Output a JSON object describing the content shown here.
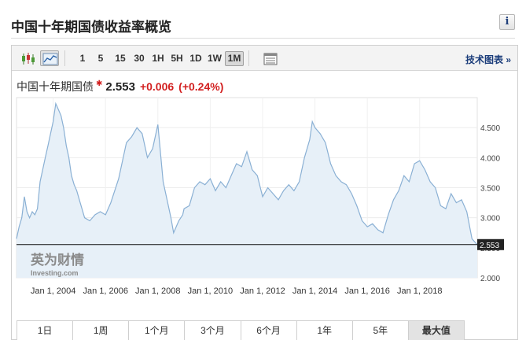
{
  "header": {
    "title": "中国十年期国债收益率概览",
    "info_label": "i"
  },
  "toolbar": {
    "timeframes": [
      "1",
      "5",
      "15",
      "30",
      "1H",
      "5H",
      "1D",
      "1W",
      "1M"
    ],
    "active_timeframe": "1M",
    "tech_chart_link": "技术图表 »"
  },
  "quote": {
    "name": "中国十年期国债",
    "value": "2.553",
    "change": "+0.006",
    "change_pct": "(+0.24%)"
  },
  "watermark": {
    "cn": "英为财情",
    "en": "Investing.com"
  },
  "ranges": [
    "1日",
    "1周",
    "1个月",
    "3个月",
    "6个月",
    "1年",
    "5年",
    "最大值"
  ],
  "active_range": "最大值",
  "colors": {
    "line": "#8ab0d4",
    "area": "#e7f0f8",
    "positive": "#d21f1f",
    "link": "#1a3c7a"
  },
  "chart_data": {
    "type": "area",
    "title": "",
    "xlabel": "",
    "ylabel": "",
    "ylim": [
      2.0,
      5.0
    ],
    "yticks": [
      "4.500",
      "4.000",
      "3.500",
      "3.000",
      "2.500",
      "2.000"
    ],
    "ytick_values": [
      4.5,
      4.0,
      3.5,
      3.0,
      2.5,
      2.0
    ],
    "xticks": [
      "Jan 1, 2004",
      "Jan 1, 2006",
      "Jan 1, 2008",
      "Jan 1, 2010",
      "Jan 1, 2012",
      "Jan 1, 2014",
      "Jan 1, 2016",
      "Jan 1, 2018"
    ],
    "xtick_values": [
      2004,
      2006,
      2008,
      2010,
      2012,
      2014,
      2016,
      2018
    ],
    "xlim": [
      2002.6,
      2020.2
    ],
    "last_price": 2.553,
    "last_price_label": "2.553",
    "series": [
      {
        "x": [
          2002.6,
          2002.7,
          2002.8,
          2002.9,
          2003.0,
          2003.1,
          2003.2,
          2003.3,
          2003.4,
          2003.5,
          2003.6,
          2003.7,
          2003.8,
          2003.9,
          2004.0,
          2004.1,
          2004.2,
          2004.3,
          2004.4,
          2004.5,
          2004.6,
          2004.7,
          2004.8,
          2004.9,
          2005.0,
          2005.2,
          2005.4,
          2005.6,
          2005.8,
          2006.0,
          2006.2,
          2006.5,
          2006.8,
          2007.0,
          2007.2,
          2007.4,
          2007.6,
          2007.8,
          2008.0,
          2008.2,
          2008.4,
          2008.5,
          2008.6,
          2008.8,
          2008.95,
          2009.0,
          2009.2,
          2009.4,
          2009.6,
          2009.8,
          2010.0,
          2010.2,
          2010.4,
          2010.6,
          2010.8,
          2011.0,
          2011.2,
          2011.4,
          2011.6,
          2011.8,
          2012.0,
          2012.2,
          2012.4,
          2012.6,
          2012.8,
          2013.0,
          2013.2,
          2013.4,
          2013.6,
          2013.8,
          2013.9,
          2014.0,
          2014.2,
          2014.4,
          2014.6,
          2014.8,
          2015.0,
          2015.2,
          2015.4,
          2015.6,
          2015.8,
          2016.0,
          2016.2,
          2016.4,
          2016.6,
          2016.8,
          2017.0,
          2017.2,
          2017.4,
          2017.6,
          2017.8,
          2018.0,
          2018.2,
          2018.4,
          2018.6,
          2018.8,
          2019.0,
          2019.2,
          2019.4,
          2019.6,
          2019.8,
          2020.0,
          2020.2
        ],
        "y": [
          2.65,
          2.85,
          3.0,
          3.35,
          3.1,
          3.0,
          3.1,
          3.05,
          3.15,
          3.6,
          3.8,
          4.0,
          4.2,
          4.4,
          4.6,
          4.9,
          4.8,
          4.7,
          4.5,
          4.2,
          4.0,
          3.7,
          3.55,
          3.45,
          3.3,
          3.0,
          2.95,
          3.05,
          3.1,
          3.05,
          3.25,
          3.65,
          4.25,
          4.35,
          4.5,
          4.4,
          4.0,
          4.15,
          4.55,
          3.6,
          3.2,
          3.0,
          2.75,
          2.95,
          3.05,
          3.15,
          3.2,
          3.5,
          3.6,
          3.55,
          3.65,
          3.45,
          3.6,
          3.5,
          3.7,
          3.9,
          3.85,
          4.1,
          3.8,
          3.7,
          3.35,
          3.5,
          3.4,
          3.3,
          3.45,
          3.55,
          3.45,
          3.6,
          4.0,
          4.3,
          4.6,
          4.5,
          4.4,
          4.25,
          3.9,
          3.7,
          3.6,
          3.55,
          3.4,
          3.2,
          2.95,
          2.85,
          2.9,
          2.8,
          2.75,
          3.05,
          3.3,
          3.45,
          3.7,
          3.6,
          3.9,
          3.95,
          3.8,
          3.6,
          3.5,
          3.2,
          3.15,
          3.4,
          3.25,
          3.3,
          3.1,
          2.65,
          2.55
        ]
      }
    ]
  }
}
